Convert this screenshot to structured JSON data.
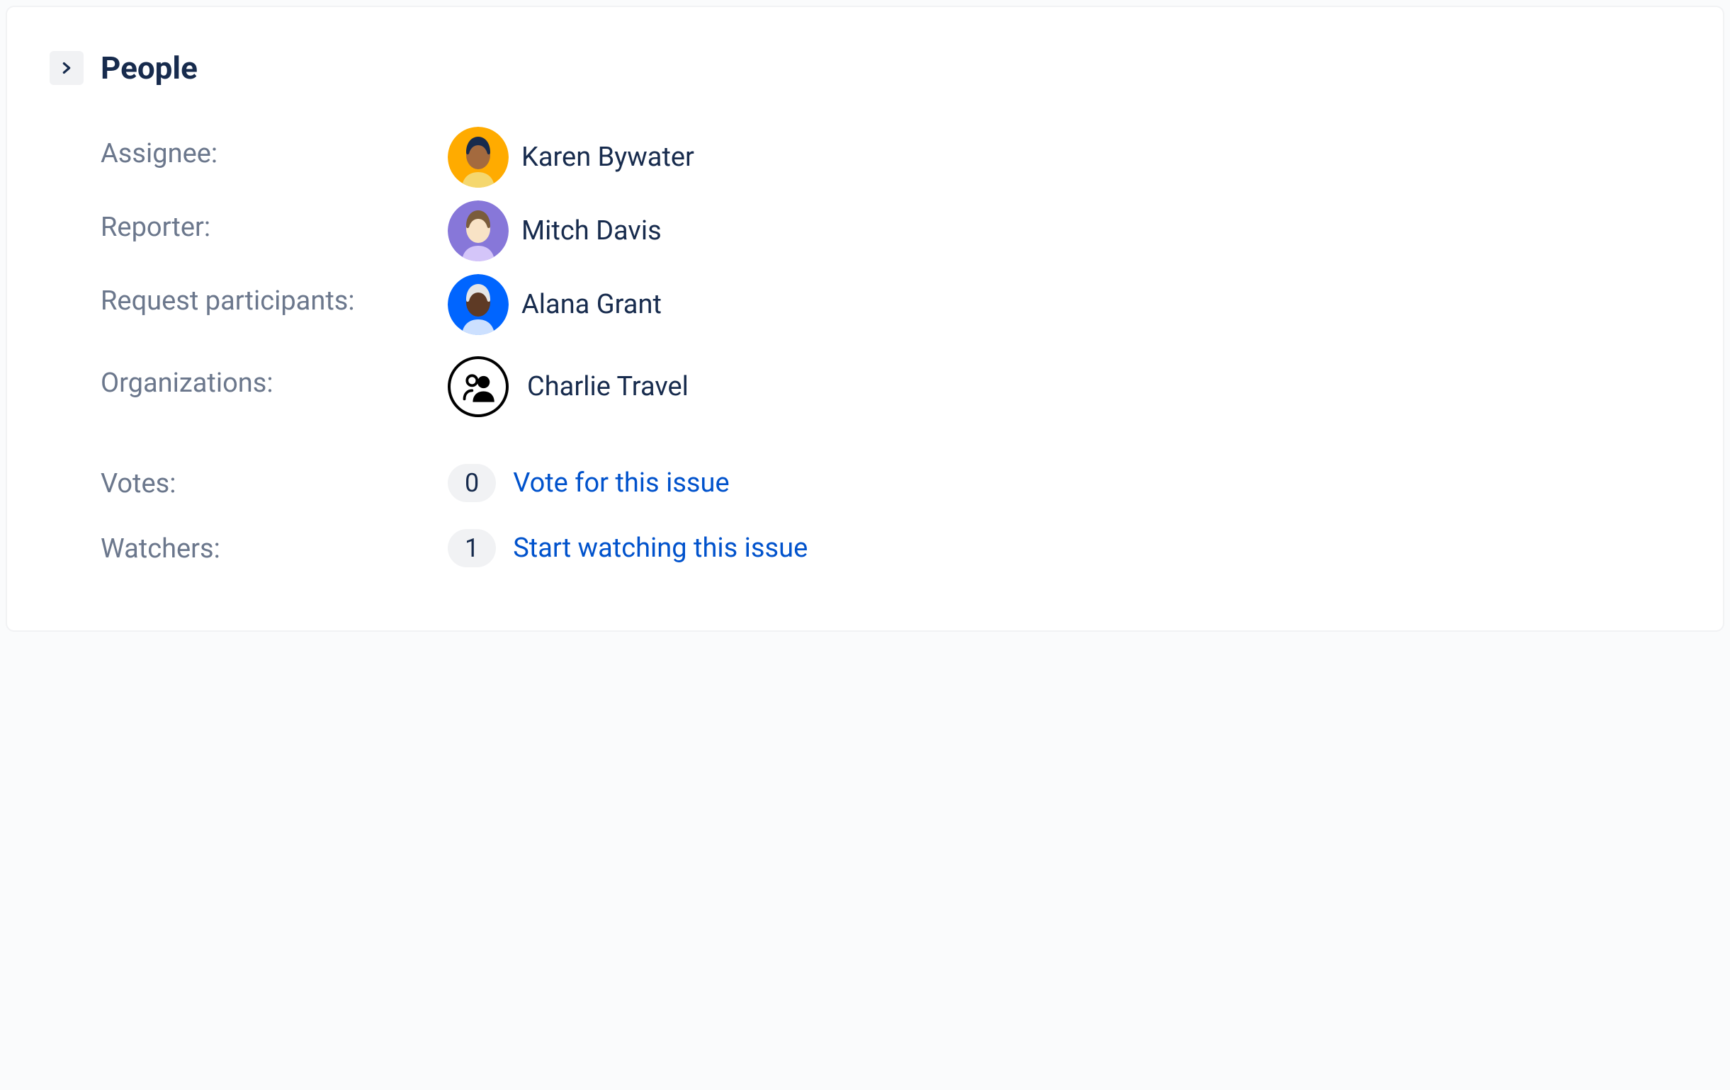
{
  "section": {
    "title": "People"
  },
  "fields": {
    "assignee": {
      "label": "Assignee:",
      "name": "Karen Bywater",
      "avatar": {
        "bg": "#ffab00",
        "face": "#a46a3e",
        "hair": "#172b4d",
        "body": "#f5d76e"
      }
    },
    "reporter": {
      "label": "Reporter:",
      "name": "Mitch Davis",
      "avatar": {
        "bg": "#8777d9",
        "face": "#f8e3c6",
        "hair": "#7a5c3b",
        "body": "#d4c5f9"
      }
    },
    "participants": {
      "label": "Request participants:",
      "name": "Alana Grant",
      "avatar": {
        "bg": "#0065ff",
        "face": "#5e3a25",
        "hair": "#e6e6e6",
        "body": "#cce0ff"
      }
    },
    "organizations": {
      "label": "Organizations:",
      "name": "Charlie Travel"
    },
    "votes": {
      "label": "Votes:",
      "count": "0",
      "action": "Vote for this issue"
    },
    "watchers": {
      "label": "Watchers:",
      "count": "1",
      "action": "Start watching this issue"
    }
  }
}
